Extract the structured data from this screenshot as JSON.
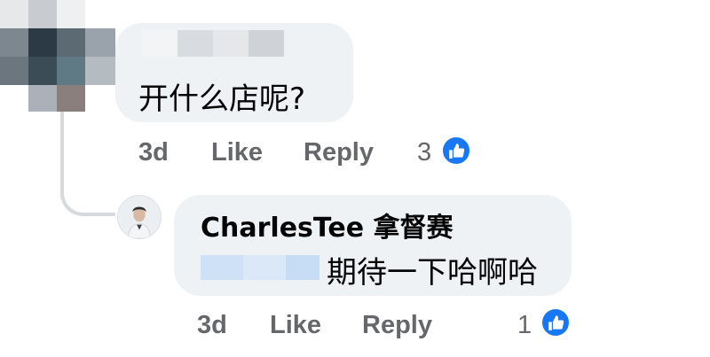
{
  "colors": {
    "bubble_bg": "#eff2f5",
    "action_text": "#65676b",
    "like_blue": "#1877f2",
    "thread_line": "#d6d9dd"
  },
  "comments": [
    {
      "author": "",
      "author_redacted": true,
      "text": "开什么店呢?",
      "timestamp": "3d",
      "like_label": "Like",
      "reply_label": "Reply",
      "reaction_count": "3",
      "reaction_icon": "like-icon"
    },
    {
      "author": "CharlesTee 拿督赛",
      "mention_redacted": true,
      "text": "期待一下哈啊哈",
      "timestamp": "3d",
      "like_label": "Like",
      "reply_label": "Reply",
      "reaction_count": "1",
      "reaction_icon": "like-icon"
    }
  ]
}
